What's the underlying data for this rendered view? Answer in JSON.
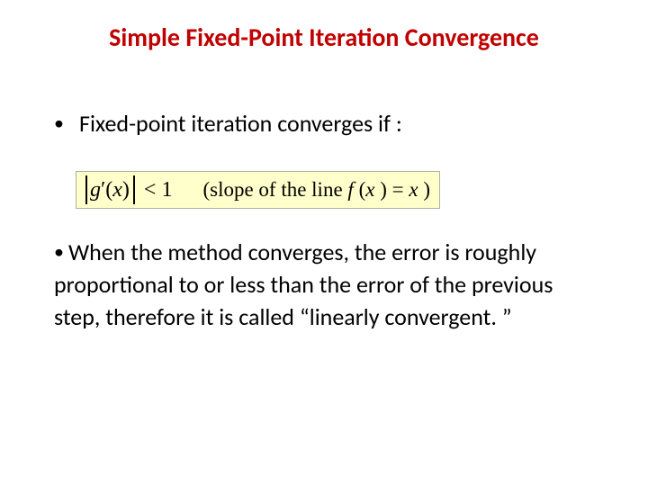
{
  "title": "Simple Fixed-Point Iteration Convergence",
  "bullet1": "Fixed-point iteration converges if :",
  "formula": {
    "abs_expr": "g′(x)",
    "rel": "< 1",
    "note": "(slope of the line f (x ) = x )"
  },
  "bullet2_lead": "• ",
  "bullet2_text": "When the method converges, the error is roughly proportional to or less than the error of the previous step, therefore it is called “linearly convergent. ”"
}
